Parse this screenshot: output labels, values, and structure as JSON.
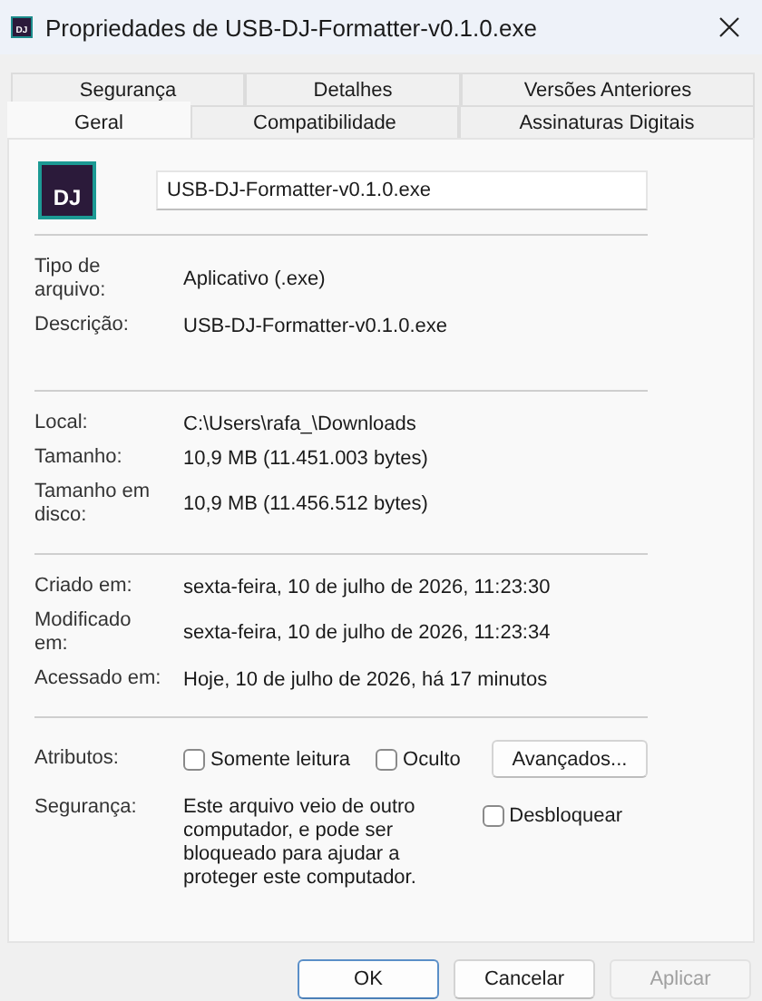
{
  "window": {
    "title": "Propriedades de USB-DJ-Formatter-v0.1.0.exe",
    "icon_text": "DJ"
  },
  "tab_rows": [
    [
      {
        "label": "Segurança",
        "selected": false
      },
      {
        "label": "Detalhes",
        "selected": false
      },
      {
        "label": "Versões Anteriores",
        "selected": false
      }
    ],
    [
      {
        "label": "Geral",
        "selected": true
      },
      {
        "label": "Compatibilidade",
        "selected": false
      },
      {
        "label": "Assinaturas Digitais",
        "selected": false
      }
    ]
  ],
  "file": {
    "icon_text": "DJ",
    "name": "USB-DJ-Formatter-v0.1.0.exe"
  },
  "sections": [
    [
      {
        "label": "Tipo de arquivo:",
        "value": "Aplicativo (.exe)"
      },
      {
        "label": "Descrição:",
        "value": "USB-DJ-Formatter-v0.1.0.exe"
      }
    ],
    [
      {
        "label": "Local:",
        "value": "C:\\Users\\rafa_\\Downloads"
      },
      {
        "label": "Tamanho:",
        "value": "10,9 MB (11.451.003 bytes)"
      },
      {
        "label": "Tamanho em disco:",
        "value": "10,9 MB (11.456.512 bytes)"
      }
    ],
    [
      {
        "label": "Criado em:",
        "value": "sexta-feira, 10 de julho de 2026, 11:23:30"
      },
      {
        "label": "Modificado em:",
        "value": "sexta-feira, 10 de julho de 2026, 11:23:34"
      },
      {
        "label": "Acessado em:",
        "value": "Hoje, 10 de julho de 2026, há 17 minutos"
      }
    ]
  ],
  "attributes": {
    "label": "Atributos:",
    "checkboxes": [
      {
        "label": "Somente leitura",
        "checked": false
      },
      {
        "label": "Oculto",
        "checked": false
      }
    ],
    "button": "Avançados..."
  },
  "security": {
    "label": "Segurança:",
    "text": "Este arquivo veio de outro computador, e pode ser bloqueado para ajudar a proteger este computador.",
    "checkbox": {
      "label": "Desbloquear",
      "checked": false
    }
  },
  "buttons": [
    {
      "label": "OK",
      "kind": "primary",
      "disabled": false
    },
    {
      "label": "Cancelar",
      "kind": "normal",
      "disabled": false
    },
    {
      "label": "Aplicar",
      "kind": "normal",
      "disabled": true
    }
  ]
}
